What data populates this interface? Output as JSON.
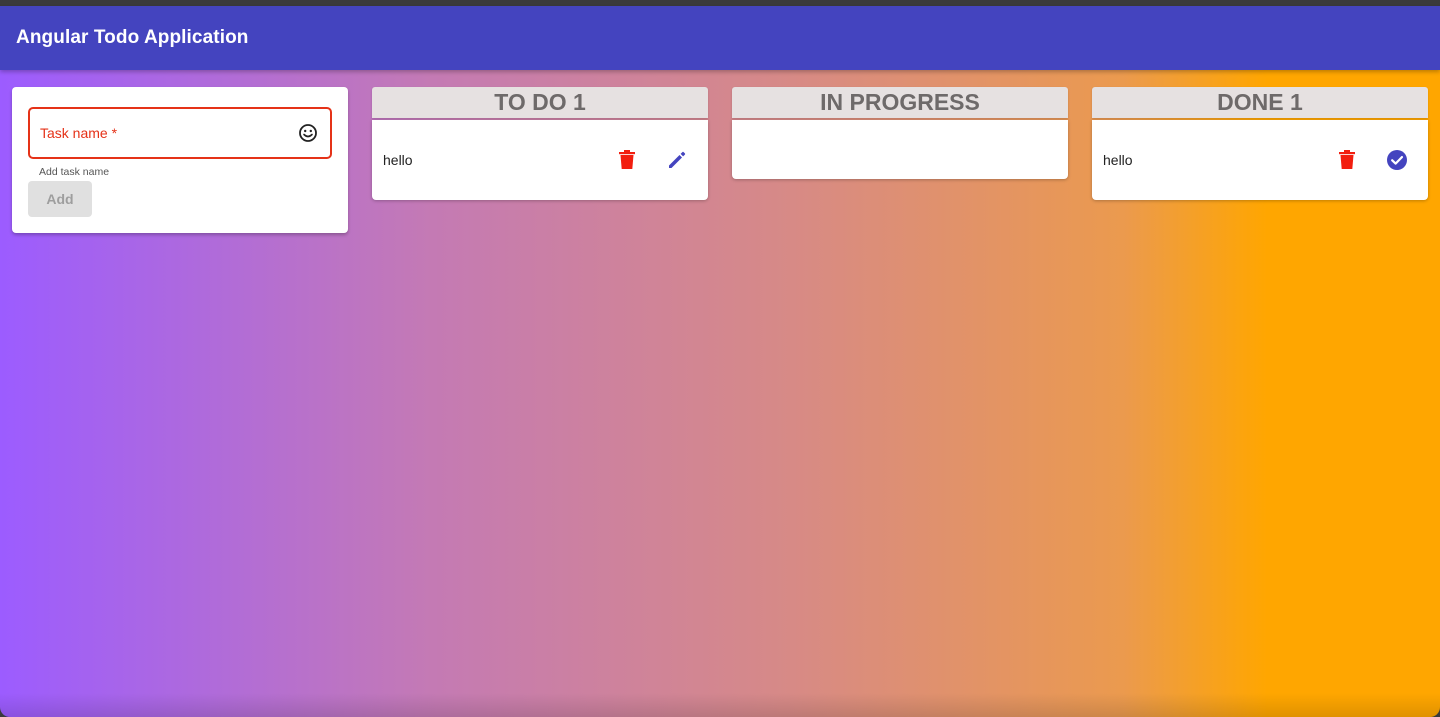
{
  "app": {
    "title": "Angular Todo Application"
  },
  "form": {
    "label": "Task name *",
    "value": "",
    "hint": "Add task name",
    "add_label": "Add",
    "icon": "emoji-smile-icon"
  },
  "columns": [
    {
      "title": "TO DO 1",
      "tasks": [
        {
          "text": "hello",
          "actions": [
            "delete-icon",
            "edit-icon"
          ]
        }
      ]
    },
    {
      "title": "IN PROGRESS",
      "tasks": []
    },
    {
      "title": "DONE 1",
      "tasks": [
        {
          "text": "hello",
          "actions": [
            "delete-icon",
            "check-circle-icon"
          ]
        }
      ]
    }
  ],
  "colors": {
    "toolbar": "#4444bf",
    "error": "#e53218",
    "delete": "#f21e0f",
    "accent": "#4444bf",
    "header_bg": "#e6e1e1",
    "gradient_start": "#9c5cff",
    "gradient_end": "#ffa600"
  }
}
